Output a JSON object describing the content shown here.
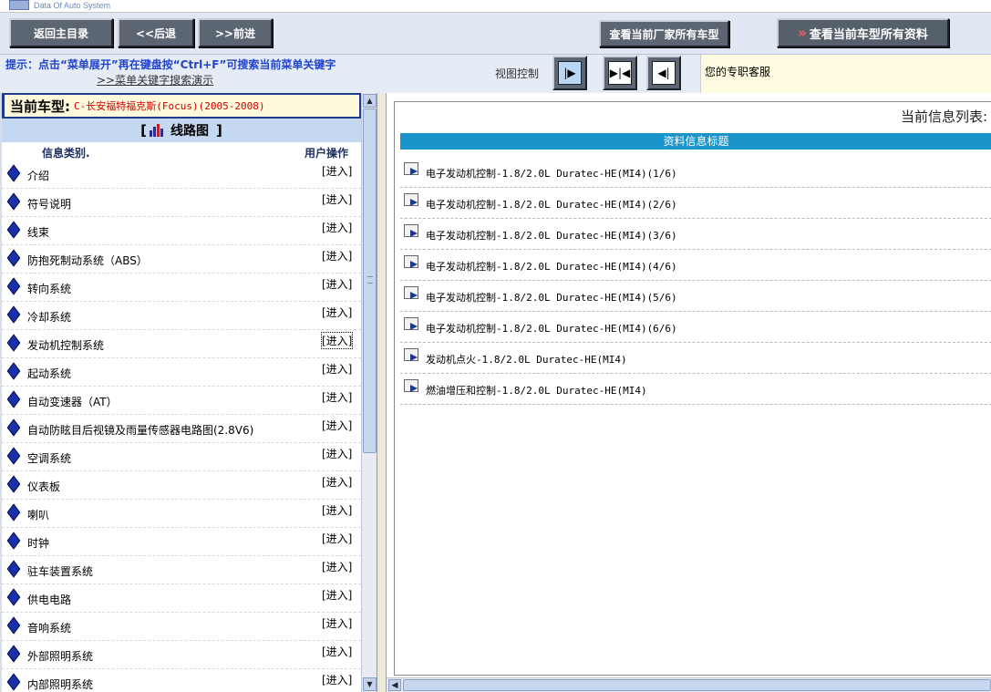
{
  "logo": {
    "text": "Data Of Auto System"
  },
  "toolbar": {
    "home_label": "返回主目录",
    "back_label": "<<后退",
    "forward_label": ">>前进",
    "maker_label": "查看当前厂家所有车型",
    "model_arrows": "»",
    "model_label": "查看当前车型所有资料"
  },
  "hint": {
    "text": "提示：点击“菜单展开”再在键盘按“Ctrl+F”可搜索当前菜单关键字",
    "link": ">>菜单关键字搜索演示"
  },
  "view_control": {
    "label": "视图控制"
  },
  "service": {
    "text": "您的专职客服"
  },
  "car_model": {
    "label": "当前车型:",
    "value": "C-长安福特福克斯(Focus)(2005-2008)"
  },
  "section": {
    "open": "[",
    "title": "线路图",
    "close": "]"
  },
  "columns": {
    "category": "信息类别.",
    "action": "用户操作"
  },
  "categories": [
    {
      "name": "介绍",
      "action": "[进入]"
    },
    {
      "name": "符号说明",
      "action": "[进入]"
    },
    {
      "name": "线束",
      "action": "[进入]"
    },
    {
      "name": "防抱死制动系统（ABS）",
      "action": "[进入]"
    },
    {
      "name": "转向系统",
      "action": "[进入]"
    },
    {
      "name": "冷却系统",
      "action": "[进入]"
    },
    {
      "name": "发动机控制系统",
      "action": "[进入]"
    },
    {
      "name": "起动系统",
      "action": "[进入]"
    },
    {
      "name": "自动变速器（AT）",
      "action": "[进入]"
    },
    {
      "name": "自动防眩目后视镜及雨量传感器电路图(2.8V6)",
      "action": "[进入]"
    },
    {
      "name": "空调系统",
      "action": "[进入]"
    },
    {
      "name": "仪表板",
      "action": "[进入]"
    },
    {
      "name": "喇叭",
      "action": "[进入]"
    },
    {
      "name": "时钟",
      "action": "[进入]"
    },
    {
      "name": "驻车装置系统",
      "action": "[进入]"
    },
    {
      "name": "供电电路",
      "action": "[进入]"
    },
    {
      "name": "音响系统",
      "action": "[进入]"
    },
    {
      "name": "外部照明系统",
      "action": "[进入]"
    },
    {
      "name": "内部照明系统",
      "action": "[进入]"
    }
  ],
  "right": {
    "list_title": "当前信息列表:",
    "header": "资料信息标题",
    "items": [
      "电子发动机控制-1.8/2.0L  Duratec-HE(MI4)(1/6)",
      "电子发动机控制-1.8/2.0L  Duratec-HE(MI4)(2/6)",
      "电子发动机控制-1.8/2.0L  Duratec-HE(MI4)(3/6)",
      "电子发动机控制-1.8/2.0L  Duratec-HE(MI4)(4/6)",
      "电子发动机控制-1.8/2.0L  Duratec-HE(MI4)(5/6)",
      "电子发动机控制-1.8/2.0L  Duratec-HE(MI4)(6/6)",
      "发动机点火-1.8/2.0L  Duratec-HE(MI4)",
      "燃油增压和控制-1.8/2.0L  Duratec-HE(MI4)"
    ]
  },
  "colors": {
    "accent": "#1a95cc",
    "button": "#5c6672",
    "hint": "#2244cc",
    "car_value": "#cc0000"
  }
}
